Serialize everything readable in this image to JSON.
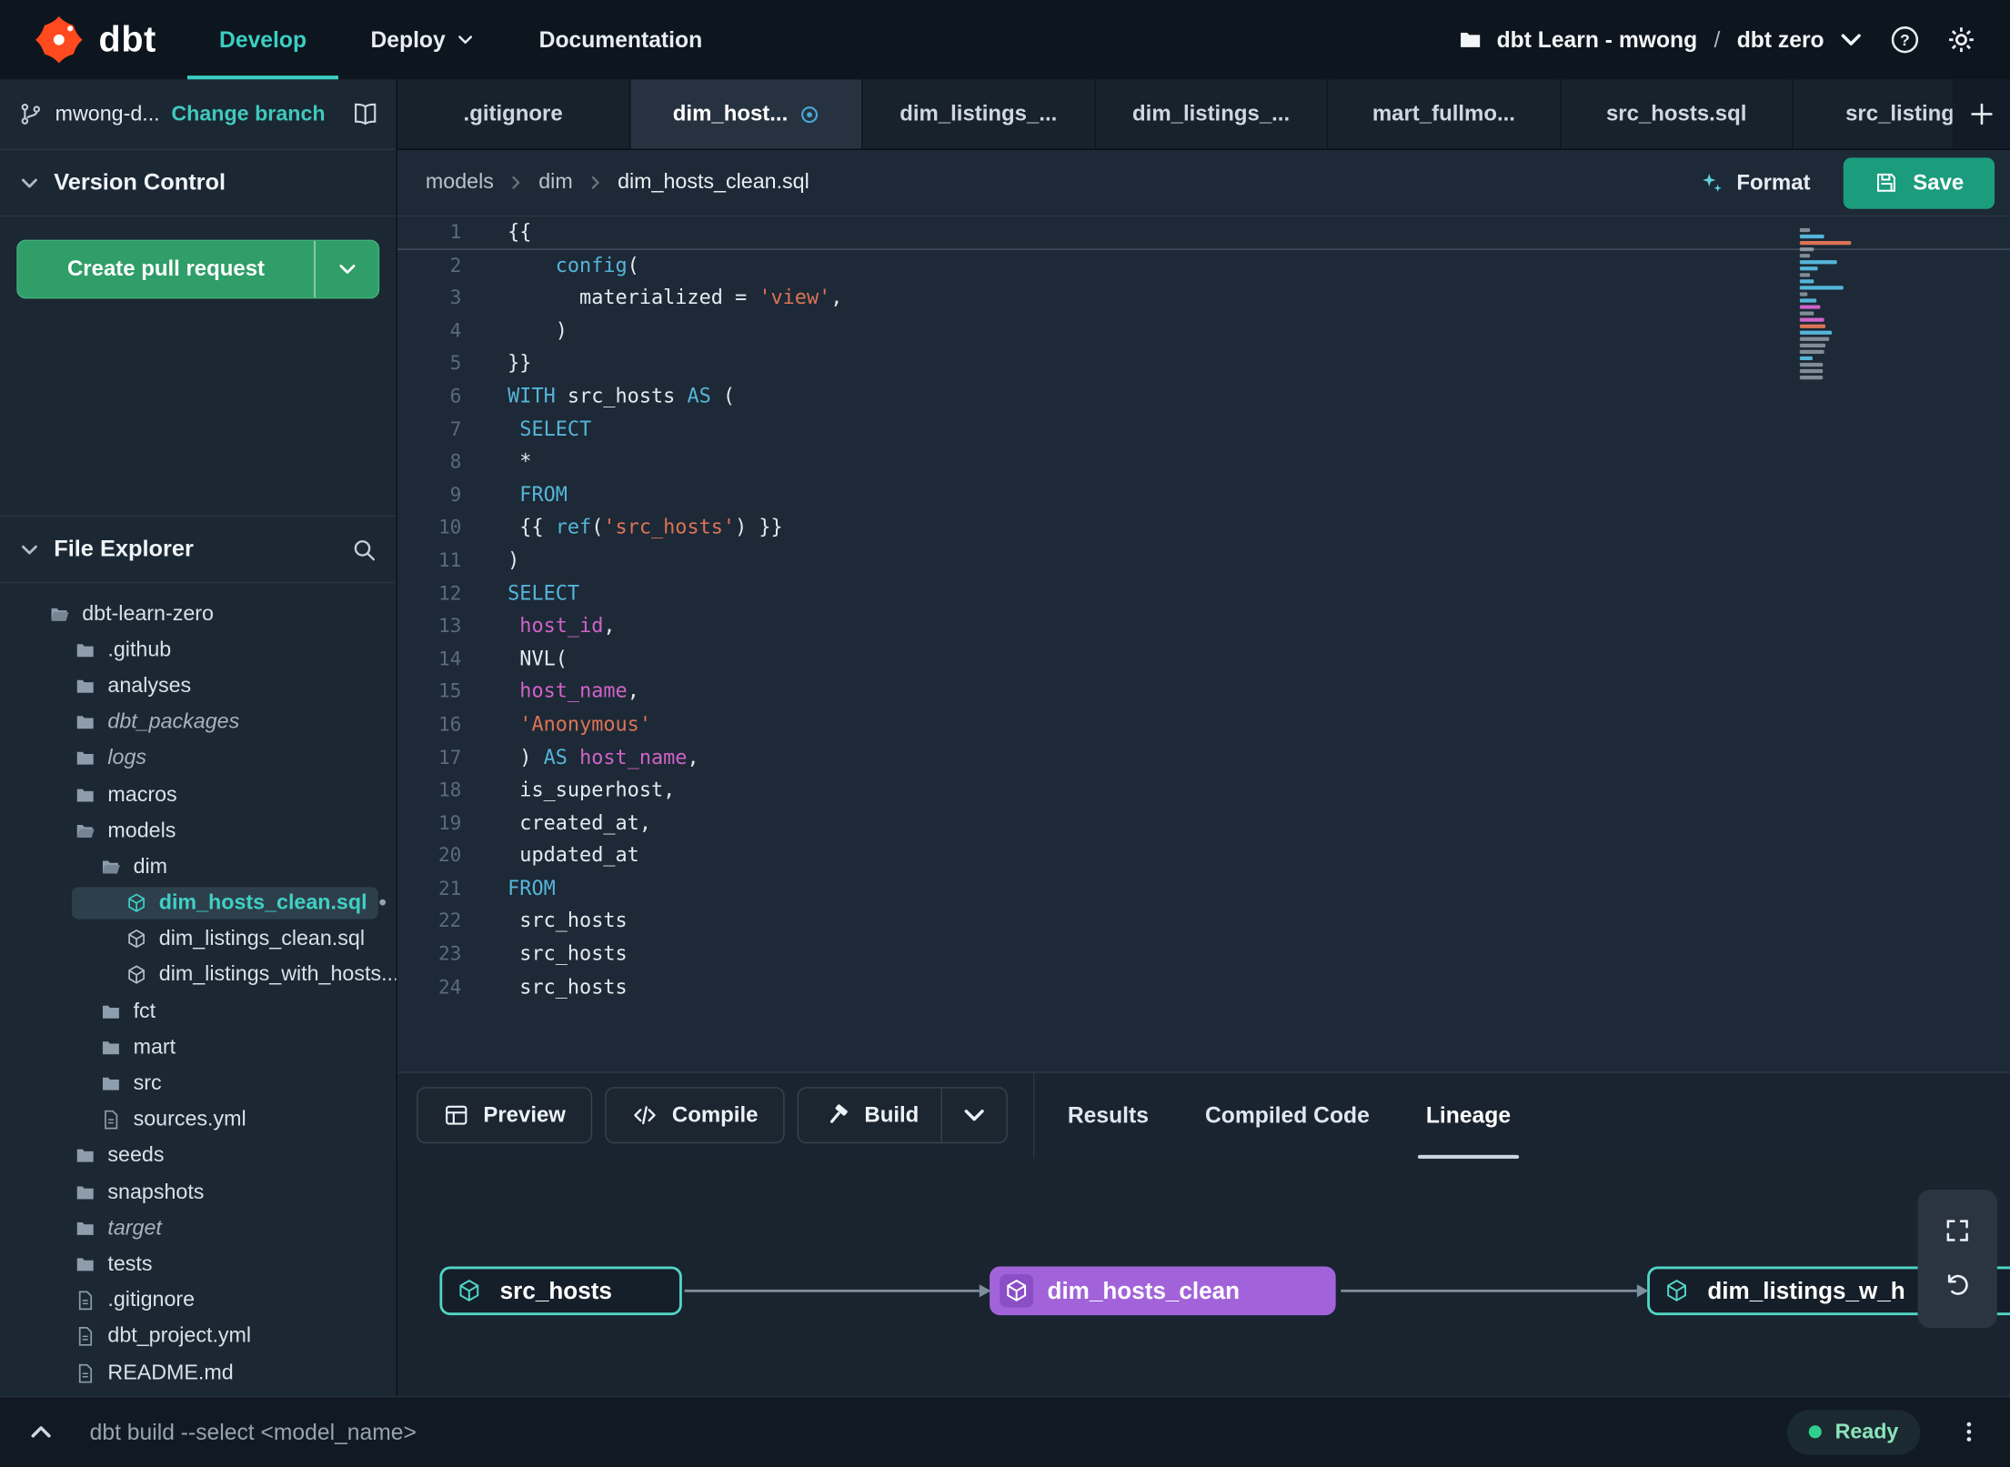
{
  "topnav": {
    "brand": "dbt",
    "items": [
      {
        "label": "Develop",
        "active": true
      },
      {
        "label": "Deploy",
        "chevron": true
      },
      {
        "label": "Documentation"
      }
    ],
    "project_name": "dbt Learn - mwong",
    "project_separator": "/",
    "environment": "dbt zero"
  },
  "sidebar": {
    "branch_name": "mwong-d...",
    "change_branch_label": "Change branch",
    "version_control_title": "Version Control",
    "create_pr_label": "Create pull request",
    "file_explorer_title": "File Explorer",
    "tree": [
      {
        "label": "dbt-learn-zero",
        "icon": "folder-open",
        "depth": 0
      },
      {
        "label": ".github",
        "icon": "folder",
        "depth": 1
      },
      {
        "label": "analyses",
        "icon": "folder",
        "depth": 1
      },
      {
        "label": "dbt_packages",
        "icon": "folder",
        "depth": 1,
        "italic": true
      },
      {
        "label": "logs",
        "icon": "folder",
        "depth": 1,
        "italic": true
      },
      {
        "label": "macros",
        "icon": "folder",
        "depth": 1
      },
      {
        "label": "models",
        "icon": "folder-open",
        "depth": 1
      },
      {
        "label": "dim",
        "icon": "folder-open",
        "depth": 2
      },
      {
        "label": "dim_hosts_clean.sql",
        "icon": "cube",
        "depth": 3,
        "selected": true,
        "modified": true
      },
      {
        "label": "dim_listings_clean.sql",
        "icon": "cube",
        "depth": 3
      },
      {
        "label": "dim_listings_with_hosts...",
        "icon": "cube",
        "depth": 3
      },
      {
        "label": "fct",
        "icon": "folder",
        "depth": 2
      },
      {
        "label": "mart",
        "icon": "folder",
        "depth": 2
      },
      {
        "label": "src",
        "icon": "folder",
        "depth": 2
      },
      {
        "label": "sources.yml",
        "icon": "file",
        "depth": 2
      },
      {
        "label": "seeds",
        "icon": "folder",
        "depth": 1
      },
      {
        "label": "snapshots",
        "icon": "folder",
        "depth": 1
      },
      {
        "label": "target",
        "icon": "folder",
        "depth": 1,
        "italic": true
      },
      {
        "label": "tests",
        "icon": "folder",
        "depth": 1
      },
      {
        "label": ".gitignore",
        "icon": "file",
        "depth": 1
      },
      {
        "label": "dbt_project.yml",
        "icon": "file",
        "depth": 1
      },
      {
        "label": "README.md",
        "icon": "file",
        "depth": 1
      }
    ]
  },
  "editor": {
    "tabs": [
      {
        "label": ".gitignore"
      },
      {
        "label": "dim_host...",
        "active": true,
        "modified": true
      },
      {
        "label": "dim_listings_..."
      },
      {
        "label": "dim_listings_..."
      },
      {
        "label": "mart_fullmo..."
      },
      {
        "label": "src_hosts.sql"
      },
      {
        "label": "src_listings."
      }
    ],
    "breadcrumb": [
      "models",
      "dim",
      "dim_hosts_clean.sql"
    ],
    "format_label": "Format",
    "save_label": "Save",
    "code_lines": [
      {
        "n": 1,
        "segments": [
          [
            "{{",
            "def"
          ]
        ]
      },
      {
        "n": 2,
        "segments": [
          [
            "    ",
            "def"
          ],
          [
            "config",
            "kw"
          ],
          [
            "(",
            "def"
          ]
        ]
      },
      {
        "n": 3,
        "segments": [
          [
            "      materialized = ",
            "def"
          ],
          [
            "'view'",
            "str"
          ],
          [
            ",",
            "def"
          ]
        ]
      },
      {
        "n": 4,
        "segments": [
          [
            "    )",
            "def"
          ]
        ]
      },
      {
        "n": 5,
        "segments": [
          [
            "}}",
            "def"
          ]
        ]
      },
      {
        "n": 6,
        "segments": [
          [
            "WITH",
            "kw"
          ],
          [
            " src_hosts ",
            "def"
          ],
          [
            "AS",
            "kw"
          ],
          [
            " (",
            "def"
          ]
        ]
      },
      {
        "n": 7,
        "segments": [
          [
            " ",
            "def"
          ],
          [
            "SELECT",
            "kw"
          ]
        ]
      },
      {
        "n": 8,
        "segments": [
          [
            " *",
            "def"
          ]
        ]
      },
      {
        "n": 9,
        "segments": [
          [
            " ",
            "def"
          ],
          [
            "FROM",
            "kw"
          ]
        ]
      },
      {
        "n": 10,
        "segments": [
          [
            " {{ ",
            "def"
          ],
          [
            "ref",
            "kw"
          ],
          [
            "(",
            "def"
          ],
          [
            "'src_hosts'",
            "str"
          ],
          [
            ") }}",
            "def"
          ]
        ]
      },
      {
        "n": 11,
        "segments": [
          [
            ")",
            "def"
          ]
        ]
      },
      {
        "n": 12,
        "segments": [
          [
            "SELECT",
            "kw"
          ]
        ]
      },
      {
        "n": 13,
        "segments": [
          [
            " ",
            "def"
          ],
          [
            "host_id",
            "ident"
          ],
          [
            ",",
            "def"
          ]
        ]
      },
      {
        "n": 14,
        "segments": [
          [
            " NVL(",
            "def"
          ]
        ]
      },
      {
        "n": 15,
        "segments": [
          [
            " ",
            "def"
          ],
          [
            "host_name",
            "ident"
          ],
          [
            ",",
            "def"
          ]
        ]
      },
      {
        "n": 16,
        "segments": [
          [
            " ",
            "def"
          ],
          [
            "'Anonymous'",
            "str"
          ]
        ]
      },
      {
        "n": 17,
        "segments": [
          [
            " ) ",
            "def"
          ],
          [
            "AS",
            "kw"
          ],
          [
            " ",
            "def"
          ],
          [
            "host_name",
            "ident"
          ],
          [
            ",",
            "def"
          ]
        ]
      },
      {
        "n": 18,
        "segments": [
          [
            " is_superhost,",
            "def"
          ]
        ]
      },
      {
        "n": 19,
        "segments": [
          [
            " created_at,",
            "def"
          ]
        ]
      },
      {
        "n": 20,
        "segments": [
          [
            " updated_at",
            "def"
          ]
        ]
      },
      {
        "n": 21,
        "segments": [
          [
            "FROM",
            "kw"
          ]
        ]
      },
      {
        "n": 22,
        "segments": [
          [
            " src_hosts",
            "def"
          ]
        ]
      },
      {
        "n": 23,
        "segments": [
          [
            " src_hosts",
            "def"
          ]
        ]
      },
      {
        "n": 24,
        "segments": [
          [
            " src_hosts",
            "def"
          ]
        ]
      }
    ]
  },
  "panel": {
    "actions": [
      {
        "label": "Preview",
        "icon": "grid"
      },
      {
        "label": "Compile",
        "icon": "code"
      },
      {
        "label": "Build",
        "icon": "hammer",
        "split": true
      }
    ],
    "tabs": [
      {
        "label": "Results"
      },
      {
        "label": "Compiled Code"
      },
      {
        "label": "Lineage",
        "active": true
      }
    ],
    "lineage_nodes": [
      {
        "label": "src_hosts",
        "style": "teal"
      },
      {
        "label": "dim_hosts_clean",
        "style": "purple"
      },
      {
        "label": "dim_listings_w_h",
        "style": "teal"
      }
    ]
  },
  "footer": {
    "command": "dbt build --select <model_name>",
    "status": "Ready"
  },
  "colors": {
    "accent_teal": "#3fd1c4",
    "brand_orange": "#ff4a1f",
    "pr_green": "#2f9e68",
    "save_teal": "#1a9c7d",
    "node_purple": "#a263da",
    "status_green": "#2fd08c",
    "syntax_keyword": "#55b5d9",
    "syntax_string": "#dd7356",
    "syntax_identifier": "#d063c8"
  }
}
